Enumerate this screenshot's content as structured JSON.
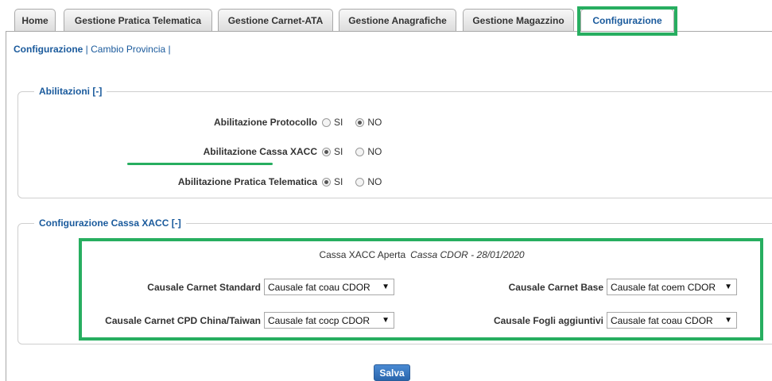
{
  "tabs": [
    {
      "label": "Home",
      "active": false
    },
    {
      "label": "Gestione Pratica Telematica",
      "active": false
    },
    {
      "label": "Gestione Carnet-ATA",
      "active": false
    },
    {
      "label": "Gestione Anagrafiche",
      "active": false
    },
    {
      "label": "Gestione Magazzino",
      "active": false
    },
    {
      "label": "Configurazione",
      "active": true
    }
  ],
  "breadcrumb": {
    "current": "Configurazione",
    "separator": "|",
    "link": "Cambio Provincia",
    "trailing": "|"
  },
  "abilitazioni": {
    "title": "Abilitazioni",
    "toggle": "[-]",
    "options": {
      "si": "SI",
      "no": "NO"
    },
    "rows": [
      {
        "label": "Abilitazione Protocollo",
        "selected": "NO"
      },
      {
        "label": "Abilitazione Cassa XACC",
        "selected": "SI"
      },
      {
        "label": "Abilitazione Pratica Telematica",
        "selected": "SI"
      }
    ]
  },
  "cassa": {
    "title": "Configurazione Cassa XACC",
    "toggle": "[-]",
    "status_label": "Cassa XACC Aperta",
    "status_value": "Cassa CDOR - 28/01/2020",
    "fields": {
      "standard": {
        "label": "Causale Carnet Standard",
        "value": "Causale fat coau CDOR"
      },
      "base": {
        "label": "Causale Carnet Base",
        "value": "Causale fat coem CDOR"
      },
      "cpd": {
        "label": "Causale Carnet CPD China/Taiwan",
        "value": "Causale fat cocp CDOR"
      },
      "fogli": {
        "label": "Causale Fogli aggiuntivi",
        "value": "Causale fat coau CDOR"
      }
    },
    "arrow": "▼"
  },
  "save_label": "Salva",
  "colors": {
    "accent": "#1a5a9c",
    "highlight": "#27ae60",
    "button": "#2a66ad"
  }
}
